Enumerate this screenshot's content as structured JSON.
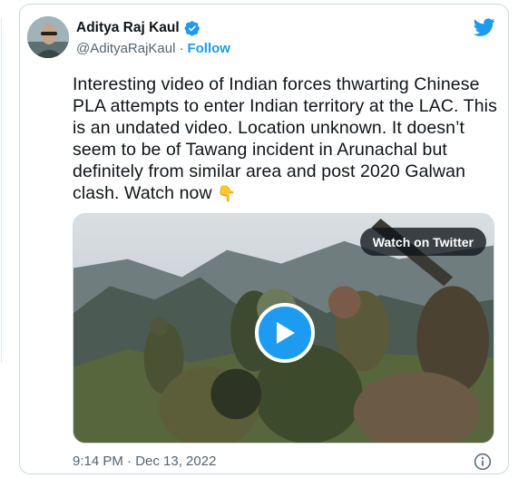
{
  "author": {
    "display_name": "Aditya Raj Kaul",
    "handle": "@AdityaRajKaul",
    "separator": "·",
    "follow_label": "Follow",
    "verified": true
  },
  "tweet": {
    "text": "Interesting video of Indian forces thwarting Chinese PLA attempts to enter Indian territory at the LAC. This is an undated video. Location unknown. It doesn’t seem to be of Tawang incident in Arunachal but definitely from similar area and post 2020 Galwan clash. Watch now",
    "emoji": "👇"
  },
  "media": {
    "watch_label": "Watch on Twitter",
    "type": "video"
  },
  "footer": {
    "timestamp": "9:14 PM · Dec 13, 2022"
  },
  "icons": {
    "brand": "twitter-bird-icon",
    "verified": "verified-badge-icon",
    "play": "play-icon",
    "info": "info-icon"
  },
  "colors": {
    "accent": "#1d9bf0",
    "text": "#0f1419",
    "secondary": "#536471",
    "border": "#cfd9de"
  }
}
